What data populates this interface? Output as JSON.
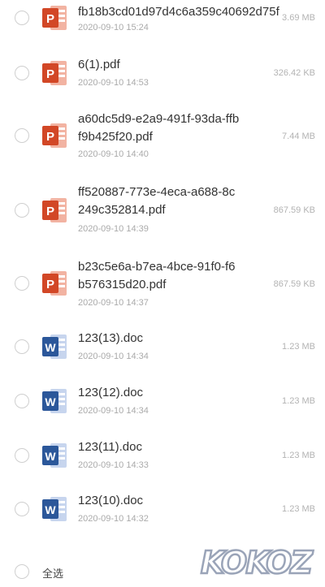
{
  "files": [
    {
      "type": "ppt",
      "name": "fb18b3cd01d97d4c6a359c40692d75f",
      "date": "2020-09-10 15:24",
      "size": "3.69 MB"
    },
    {
      "type": "ppt",
      "name": "6(1).pdf",
      "date": "2020-09-10 14:53",
      "size": "326.42 KB"
    },
    {
      "type": "ppt",
      "name": "a60dc5d9-e2a9-491f-93da-ffbf9b425f20.pdf",
      "date": "2020-09-10 14:40",
      "size": "7.44 MB"
    },
    {
      "type": "ppt",
      "name": "ff520887-773e-4eca-a688-8c249c352814.pdf",
      "date": "2020-09-10 14:39",
      "size": "867.59 KB"
    },
    {
      "type": "ppt",
      "name": "b23c5e6a-b7ea-4bce-91f0-f6b576315d20.pdf",
      "date": "2020-09-10 14:37",
      "size": "867.59 KB"
    },
    {
      "type": "doc",
      "name": "123(13).doc",
      "date": "2020-09-10 14:34",
      "size": "1.23 MB"
    },
    {
      "type": "doc",
      "name": "123(12).doc",
      "date": "2020-09-10 14:34",
      "size": "1.23 MB"
    },
    {
      "type": "doc",
      "name": "123(11).doc",
      "date": "2020-09-10 14:33",
      "size": "1.23 MB"
    },
    {
      "type": "doc",
      "name": "123(10).doc",
      "date": "2020-09-10 14:32",
      "size": "1.23 MB"
    }
  ],
  "footer": {
    "select_all_label": "全选"
  },
  "watermark": {
    "text": "KOKOZ"
  },
  "icons": {
    "ppt": "powerpoint-icon",
    "doc": "word-icon"
  },
  "colors": {
    "ppt": "#d24726",
    "doc": "#2b579a",
    "radio_border": "#cfcfcf"
  }
}
